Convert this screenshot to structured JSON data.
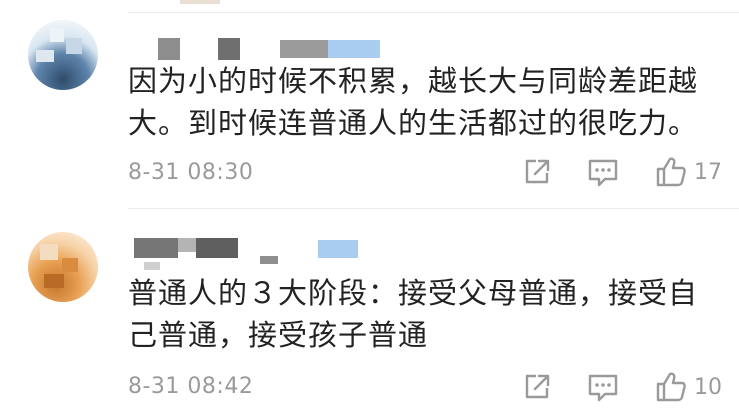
{
  "comments": [
    {
      "text": "因为小的时候不积累，越长大与同龄差距越大。到时候连普通人的生活都过的很吃力。",
      "time": "8-31 08:30",
      "likes": "17",
      "icons": {
        "share": "share-icon",
        "reply": "comment-icon",
        "like": "thumbs-up-icon"
      },
      "avatar_color": "#5f85ab"
    },
    {
      "text": "普通人的３大阶段：接受父母普通，接受自己普通，接受孩子普通",
      "time": "8-31 08:42",
      "likes": "10",
      "icons": {
        "share": "share-icon",
        "reply": "comment-icon",
        "like": "thumbs-up-icon"
      },
      "avatar_color": "#e9a154"
    }
  ],
  "colors": {
    "text": "#222222",
    "meta": "#9a9a9a",
    "divider": "#ececec",
    "highlight": "#a9cdf1"
  }
}
